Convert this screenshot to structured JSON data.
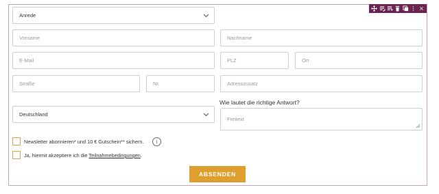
{
  "toolbar": {
    "icons": [
      "move-icon",
      "list-edit-icon",
      "list-add-icon",
      "trash-icon",
      "copy-icon",
      "more-icon",
      "close-icon"
    ]
  },
  "form": {
    "salutation": {
      "value": "Anrede"
    },
    "first_name": {
      "placeholder": "Vorname"
    },
    "last_name": {
      "placeholder": "Nachname"
    },
    "email": {
      "placeholder": "E-Mail"
    },
    "zip": {
      "placeholder": "PLZ"
    },
    "city": {
      "placeholder": "Ort"
    },
    "street": {
      "placeholder": "Straße"
    },
    "house_number": {
      "placeholder": "Nr."
    },
    "address_extra": {
      "placeholder": "Adresszusatz"
    },
    "country": {
      "value": "Deutschland"
    },
    "question": {
      "label": "Wie lautet die richtige Antwort?",
      "placeholder": "Freitext"
    },
    "newsletter": {
      "label": "Newsletter abonnieren* und 10 € Gutschein** sichern.",
      "info_glyph": "i"
    },
    "terms": {
      "label_prefix": "Ja, hiermit akzeptiere ich die ",
      "link": "Teilnahmebedingungen",
      "label_suffix": "."
    },
    "submit_label": "ABSENDEN"
  },
  "colors": {
    "accent": "#dda02f",
    "toolbar_bg": "#6b2352",
    "frame_border": "#c9a3b8",
    "field_border": "#cfcfcf"
  }
}
